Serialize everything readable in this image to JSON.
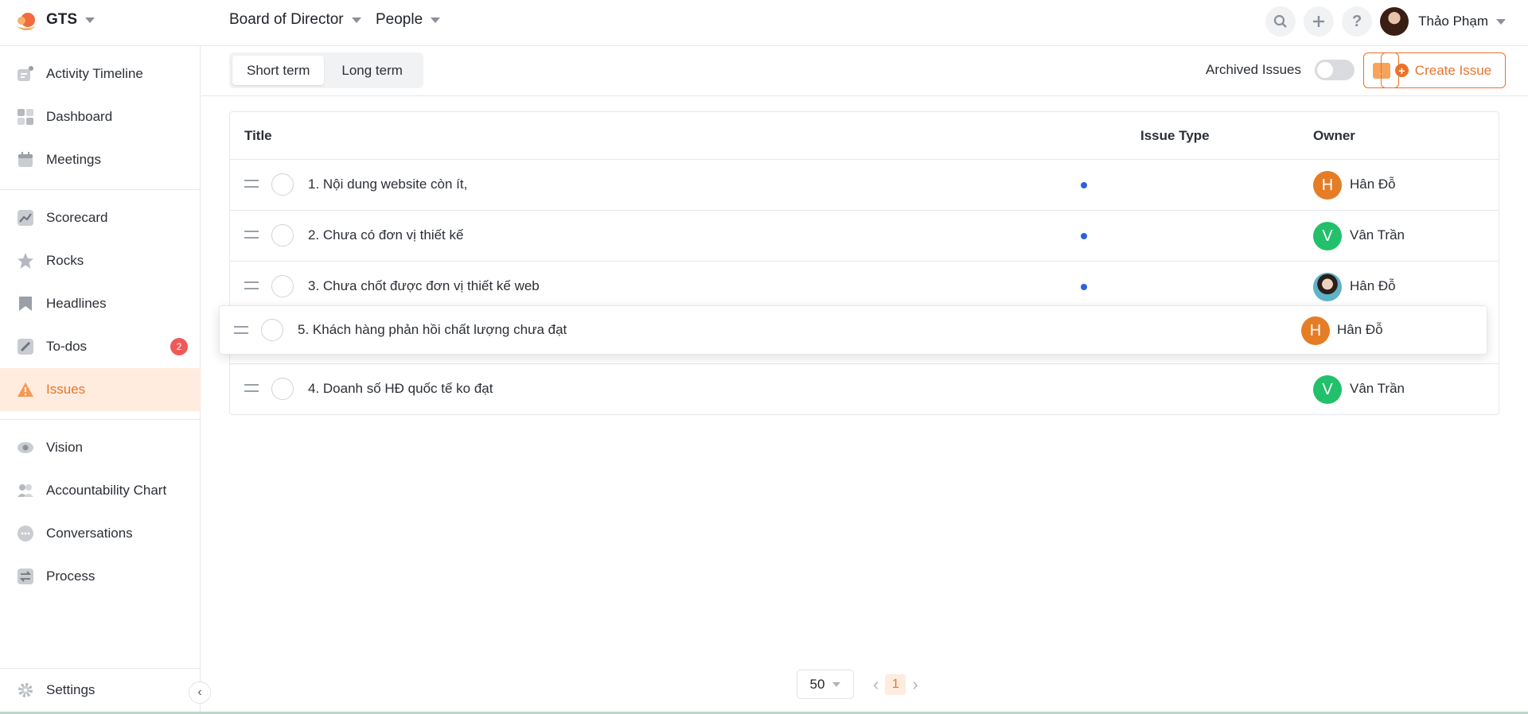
{
  "topbar": {
    "brand": "GTS",
    "crumb_team": "Board of Director",
    "crumb_section": "People",
    "user_name": "Thảo Phạm",
    "icons": [
      "search-icon",
      "plus-icon",
      "help-icon"
    ]
  },
  "sidebar": {
    "items": [
      {
        "label": "Activity Timeline",
        "icon": "timeline-icon"
      },
      {
        "label": "Dashboard",
        "icon": "dashboard-icon"
      },
      {
        "label": "Meetings",
        "icon": "calendar-icon"
      },
      {
        "label": "Scorecard",
        "icon": "chart-icon"
      },
      {
        "label": "Rocks",
        "icon": "star-icon"
      },
      {
        "label": "Headlines",
        "icon": "bookmark-icon"
      },
      {
        "label": "To-dos",
        "icon": "pencil-icon",
        "badge": "2"
      },
      {
        "label": "Issues",
        "icon": "warning-icon",
        "active": true
      },
      {
        "label": "Vision",
        "icon": "eye-icon"
      },
      {
        "label": "Accountability Chart",
        "icon": "people-icon"
      },
      {
        "label": "Conversations",
        "icon": "chat-icon"
      },
      {
        "label": "Process",
        "icon": "process-icon"
      }
    ],
    "settings": "Settings"
  },
  "subbar": {
    "tabs": [
      "Short term",
      "Long term"
    ],
    "archived_label": "Archived Issues",
    "create_label": "Create Issue"
  },
  "table": {
    "headers": {
      "title": "Title",
      "issue_type": "Issue Type",
      "owner": "Owner"
    },
    "rows": [
      {
        "title": "1. Nội dung website còn ít,",
        "owner": "Hân Đỗ",
        "initial": "H",
        "has_dot": true
      },
      {
        "title": "2. Chưa có đơn vị thiết kế",
        "owner": "Vân Trần",
        "initial": "V",
        "has_dot": true
      },
      {
        "title": "3. Chưa chốt được đơn vị thiết kế web",
        "owner": "Hân Đỗ",
        "initial": "",
        "has_dot": true
      },
      {
        "title": "4. Doanh số HĐ quốc tế ko đạt",
        "owner": "Vân Trần",
        "initial": "V",
        "has_dot": false
      }
    ],
    "dragging_row": {
      "title": "5. Khách hàng phản hồi chất lượng chưa đạt",
      "owner": "Hân Đỗ",
      "initial": "H"
    }
  },
  "pagination": {
    "page_size": "50",
    "current_page": "1"
  },
  "colors": {
    "accent": "#e8742b",
    "active_bg": "#ffecdf",
    "dot": "#2f5fe0",
    "avatar_orange": "#e57d26",
    "avatar_green": "#22c06a"
  }
}
